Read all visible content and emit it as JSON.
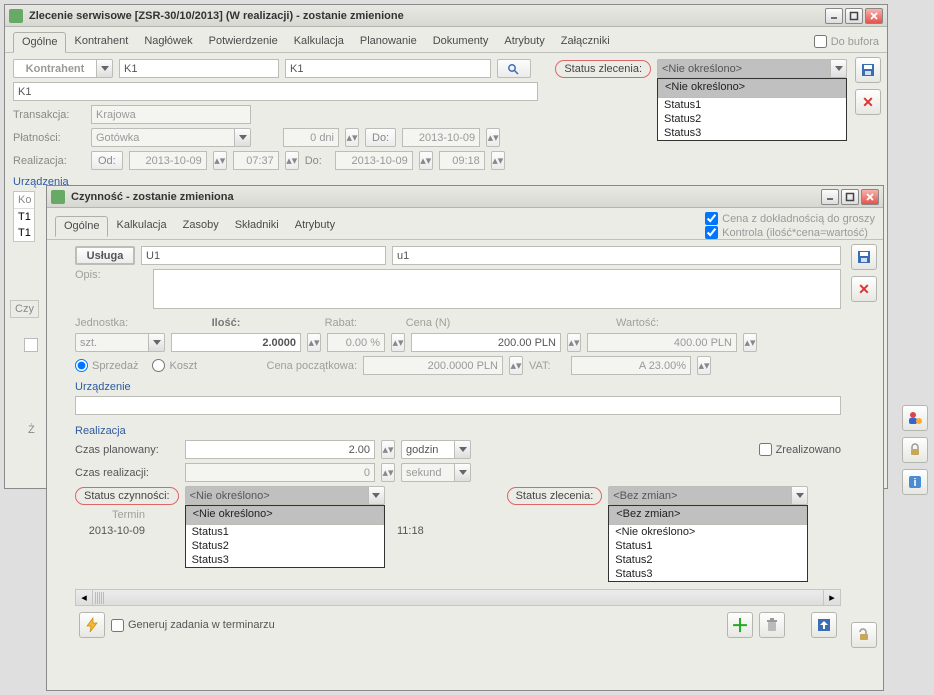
{
  "win1": {
    "title": "Zlecenie serwisowe [ZSR-30/10/2013] (W realizacji) - zostanie zmienione",
    "tabs": [
      "Ogólne",
      "Kontrahent",
      "Nagłówek",
      "Potwierdzenie",
      "Kalkulacja",
      "Planowanie",
      "Dokumenty",
      "Atrybuty",
      "Załączniki"
    ],
    "to_buffer": "Do bufora",
    "kontrahent_btn": "Kontrahent",
    "kontrahent1": "K1",
    "kontrahent2": "K1",
    "k1_line": "K1",
    "transakcja_lbl": "Transakcja:",
    "transakcja_val": "Krajowa",
    "platnosci_lbl": "Płatności:",
    "platnosci_val": "Gotówka",
    "dni_val": "0 dni",
    "do_btn": "Do:",
    "do_date": "2013-10-09",
    "realizacja_lbl": "Realizacja:",
    "od_btn": "Od:",
    "real_date1": "2013-10-09",
    "real_time1": "07:37",
    "do_lbl": "Do:",
    "real_date2": "2013-10-09",
    "real_time2": "09:18",
    "urzadzenia": "Urządzenia",
    "ko_label": "Ko",
    "t1a": "T1",
    "t1b": "T1",
    "czy": "Czy",
    "status_zlecenia_lbl": "Status zlecenia:",
    "status_zlecenia_val": "<Nie określono>",
    "status_opts": [
      "<Nie określono>",
      "Status1",
      "Status2",
      "Status3"
    ],
    "z_lbl": "Ż"
  },
  "win2": {
    "title": "Czynność - zostanie zmieniona",
    "tabs": [
      "Ogólne",
      "Kalkulacja",
      "Zasoby",
      "Składniki",
      "Atrybuty"
    ],
    "cena_precyzja": "Cena z dokładnością do groszy",
    "kontrola": "Kontrola (ilość*cena=wartość)",
    "usluga_btn": "Usługa",
    "usluga_code": "U1",
    "usluga_name": "u1",
    "opis_lbl": "Opis:",
    "jednostka_lbl": "Jednostka:",
    "jednostka_val": "szt.",
    "ilosc_lbl": "Ilość:",
    "ilosc_val": "2.0000",
    "rabat_lbl": "Rabat:",
    "rabat_val": "0.00 %",
    "cena_lbl": "Cena (N)",
    "cena_val": "200.00 PLN",
    "wartosc_lbl": "Wartość:",
    "wartosc_val": "400.00 PLN",
    "sprzedaz": "Sprzedaż",
    "koszt": "Koszt",
    "cena_pocz_lbl": "Cena początkowa:",
    "cena_pocz_val": "200.0000 PLN",
    "vat_lbl": "VAT:",
    "vat_val": "A 23.00%",
    "urzadzenie_section": "Urządzenie",
    "realizacja_section": "Realizacja",
    "czas_plan_lbl": "Czas planowany:",
    "czas_plan_val": "2.00",
    "czas_plan_unit": "godzin",
    "czas_real_lbl": "Czas realizacji:",
    "czas_real_val": "0",
    "czas_real_unit": "sekund",
    "zrealizowano": "Zrealizowano",
    "status_czyn_lbl": "Status czynności:",
    "status_czyn_val": "<Nie określono>",
    "status_czyn_opts": [
      "<Nie określono>",
      "Status1",
      "Status2",
      "Status3"
    ],
    "status_zlec_lbl": "Status zlecenia:",
    "status_zlec_val": "<Bez zmian>",
    "status_zlec_opts": [
      "<Bez zmian>",
      "<Nie określono>",
      "Status1",
      "Status2",
      "Status3"
    ],
    "termin_col": "Termin",
    "termin_date": "2013-10-09",
    "termin_time": "11:18",
    "generuj": "Generuj zadania w terminarzu"
  }
}
